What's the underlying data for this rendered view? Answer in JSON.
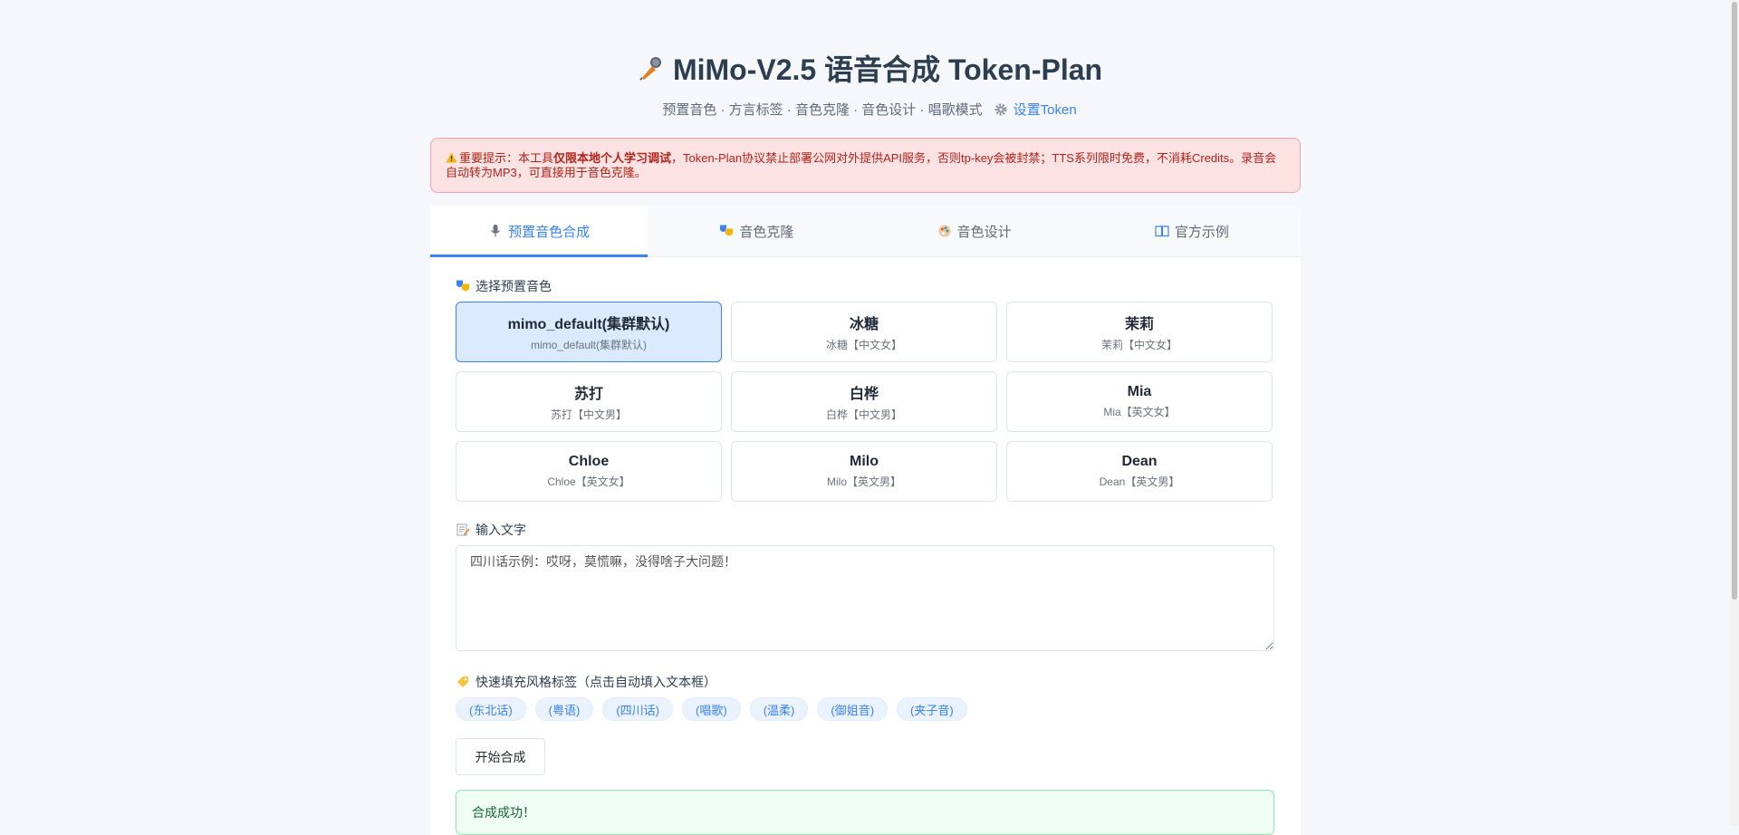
{
  "header": {
    "title": "MiMo-V2.5 语音合成 Token-Plan",
    "subtitle": "预置音色 · 方言标签 · 音色克隆 · 音色设计 · 唱歌模式",
    "token_link": "设置Token"
  },
  "warning": {
    "prefix": "重要提示：本工具",
    "bold": "仅限本地个人学习调试",
    "suffix": "，Token-Plan协议禁止部署公网对外提供API服务，否则tp-key会被封禁；TTS系列限时免费，不消耗Credits。录音会自动转为MP3，可直接用于音色克隆。"
  },
  "tabs": [
    {
      "label": "预置音色合成",
      "icon": "microphone-icon",
      "active": true
    },
    {
      "label": "音色克隆",
      "icon": "theater-masks-icon",
      "active": false
    },
    {
      "label": "音色设计",
      "icon": "palette-icon",
      "active": false
    },
    {
      "label": "官方示例",
      "icon": "book-icon",
      "active": false
    }
  ],
  "voice_section": {
    "label": "选择预置音色",
    "voices": [
      {
        "name": "mimo_default(集群默认)",
        "desc": "mimo_default(集群默认)",
        "selected": true
      },
      {
        "name": "冰糖",
        "desc": "冰糖【中文女】",
        "selected": false
      },
      {
        "name": "茉莉",
        "desc": "茉莉【中文女】",
        "selected": false
      },
      {
        "name": "苏打",
        "desc": "苏打【中文男】",
        "selected": false
      },
      {
        "name": "白桦",
        "desc": "白桦【中文男】",
        "selected": false
      },
      {
        "name": "Mia",
        "desc": "Mia【英文女】",
        "selected": false
      },
      {
        "name": "Chloe",
        "desc": "Chloe【英文女】",
        "selected": false
      },
      {
        "name": "Milo",
        "desc": "Milo【英文男】",
        "selected": false
      },
      {
        "name": "Dean",
        "desc": "Dean【英文男】",
        "selected": false
      }
    ]
  },
  "text_section": {
    "label": "输入文字",
    "placeholder": "四川话示例：哎呀，莫慌嘛，没得啥子大问题！"
  },
  "tags_section": {
    "label": "快速填充风格标签（点击自动填入文本框）",
    "tags": [
      "(东北话)",
      "(粤语)",
      "(四川话)",
      "(唱歌)",
      "(温柔)",
      "(御姐音)",
      "(夹子音)"
    ]
  },
  "synth_button": "开始合成",
  "success_message": "合成成功！",
  "colors": {
    "accent": "#3b82f6",
    "warning_bg": "#fde2e4",
    "warning_text": "#b42318",
    "success_bg": "#f0fdf4",
    "success_text": "#166534"
  }
}
